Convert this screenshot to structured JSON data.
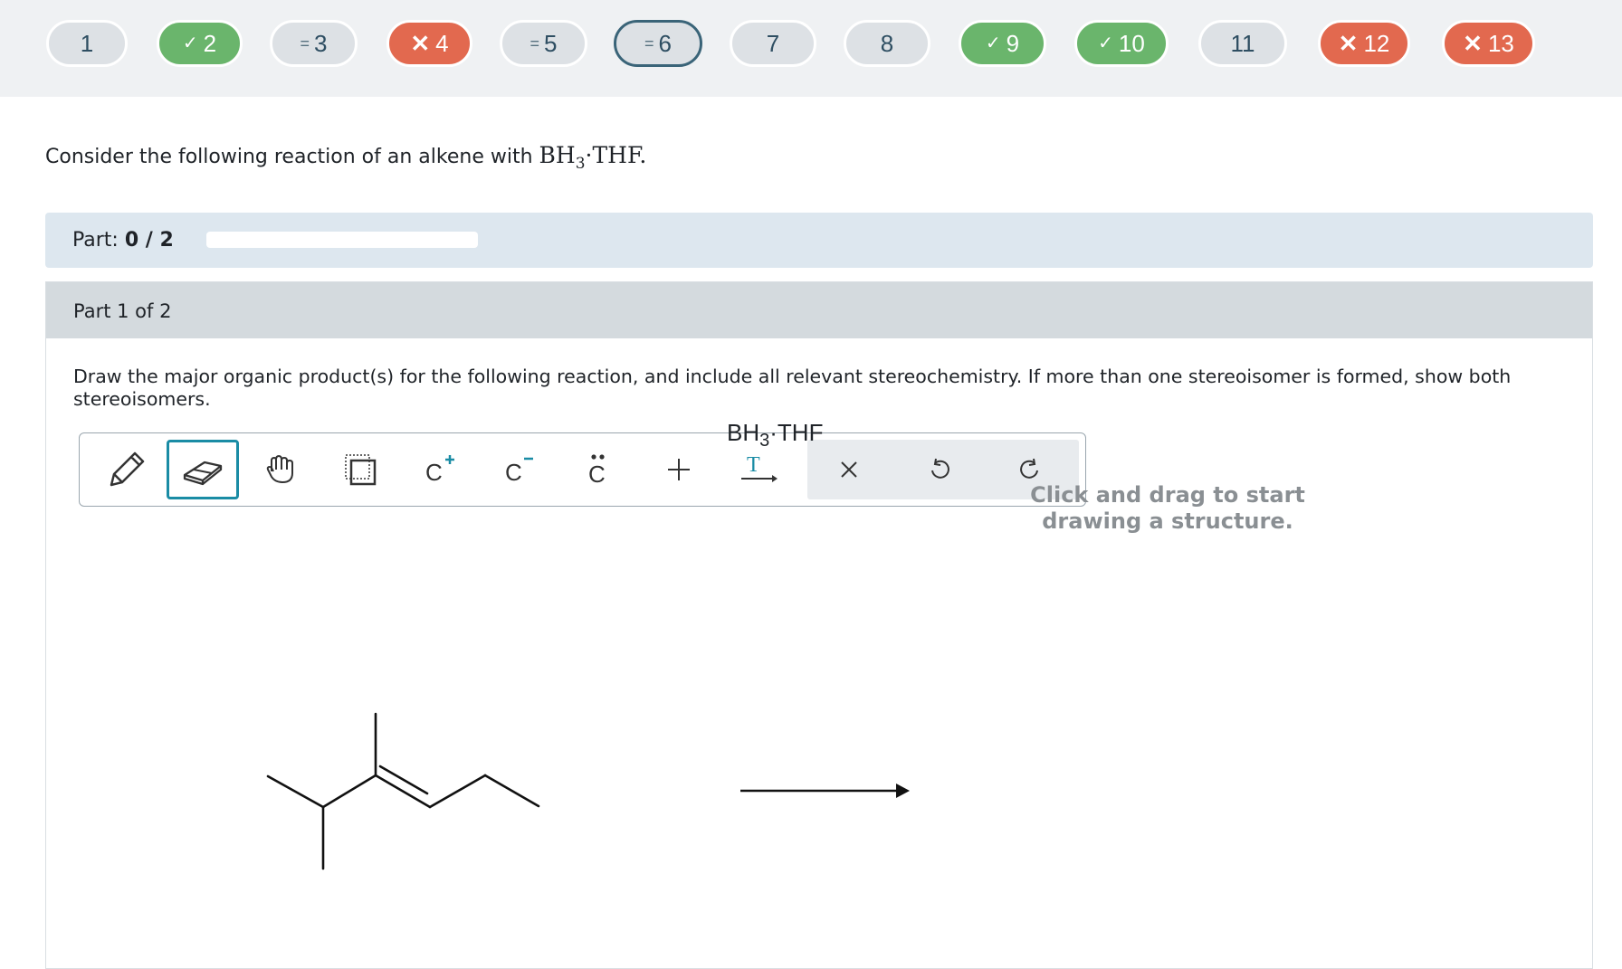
{
  "nav": {
    "questions": [
      {
        "label": "1",
        "status": "plain",
        "marker": ""
      },
      {
        "label": "2",
        "status": "correct",
        "marker": "✓"
      },
      {
        "label": "3",
        "status": "plain",
        "marker": "="
      },
      {
        "label": "4",
        "status": "wrong",
        "marker": "✕"
      },
      {
        "label": "5",
        "status": "plain",
        "marker": "="
      },
      {
        "label": "6",
        "status": "plain",
        "marker": "=",
        "current": true
      },
      {
        "label": "7",
        "status": "plain",
        "marker": ""
      },
      {
        "label": "8",
        "status": "plain",
        "marker": ""
      },
      {
        "label": "9",
        "status": "correct",
        "marker": "✓"
      },
      {
        "label": "10",
        "status": "correct",
        "marker": "✓"
      },
      {
        "label": "11",
        "status": "plain",
        "marker": ""
      },
      {
        "label": "12",
        "status": "wrong",
        "marker": "✕"
      },
      {
        "label": "13",
        "status": "wrong",
        "marker": "✕"
      }
    ],
    "colors": {
      "correct": "#6ab56c",
      "wrong": "#e2694f",
      "plain": "#dde1e5",
      "current_border": "#3a6478"
    }
  },
  "question": {
    "intro_text": "Consider the following reaction of an alkene with ",
    "reagent_main": "BH",
    "reagent_sub": "3",
    "reagent_tail": "·THF."
  },
  "progress": {
    "part_label": "Part:",
    "part_value": "0 / 2",
    "fraction": 0
  },
  "part": {
    "title": "Part 1 of 2",
    "instructions": "Draw the major organic product(s) for the following reaction, and include all relevant stereochemistry. If more than one stereoisomer is formed, show both stereoisomers."
  },
  "toolbar": {
    "tools": [
      "pencil-icon",
      "eraser-icon",
      "hand-icon",
      "select-icon",
      "carbocation-icon",
      "carbanion-icon",
      "lone-pair-icon",
      "plus-icon",
      "text-arrow-icon",
      "clear-icon",
      "undo-icon",
      "redo-icon"
    ],
    "selected": "eraser-icon",
    "accent": "#1a8ca5"
  },
  "reaction": {
    "reagent_main": "BH",
    "reagent_sub": "3",
    "reagent_tail": "·THF"
  },
  "canvas": {
    "hint": "Click and drag to start drawing a structure."
  }
}
